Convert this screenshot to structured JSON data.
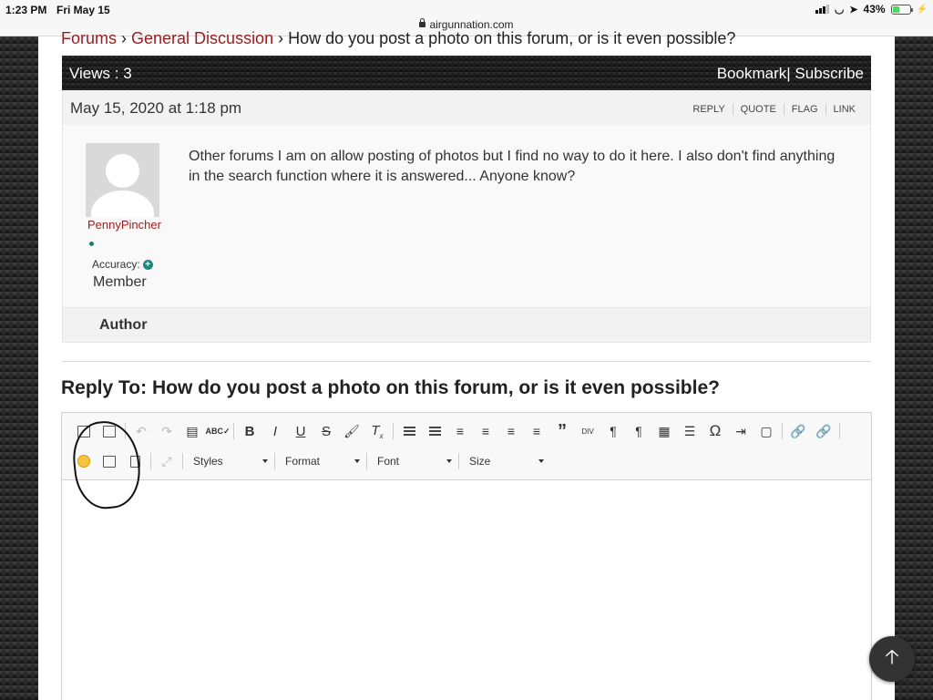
{
  "status_bar": {
    "time": "1:23 PM",
    "date": "Fri May 15",
    "url": "airgunnation.com",
    "battery": "43%",
    "battery_level": 0.43
  },
  "breadcrumb": {
    "forums": "Forums",
    "sep1": " › ",
    "category": "General Discussion",
    "sep2": " › ",
    "topic": "How do you post a photo on this forum, or is it even possible?"
  },
  "views_bar": {
    "views": "Views : 3",
    "bookmark": "Bookmark",
    "separator": "|",
    "subscribe": " Subscribe"
  },
  "post": {
    "date": "May 15, 2020 at 1:18 pm",
    "links": [
      "REPLY",
      "QUOTE",
      "FLAG",
      "LINK"
    ],
    "author": "PennyPincher",
    "accuracy_label": "Accuracy:",
    "role": "Member",
    "text": "Other forums I am on allow posting of photos but I find no way to do it here.  I also don't find anything in the search function where it is answered... Anyone know?"
  },
  "author_header": "Author",
  "reply_title": "Reply To: How do you post a photo on this forum, or is it even possible?",
  "editor": {
    "combos": [
      "Styles",
      "Format",
      "Font",
      "Size"
    ],
    "toolbar_icons_row1": [
      "paste-text-icon",
      "paste-word-icon",
      "undo-icon",
      "redo-icon",
      "template-icon",
      "spellcheck-icon",
      "bold-icon",
      "italic-icon",
      "underline-icon",
      "strikethrough-icon",
      "copy-format-icon",
      "remove-format-icon",
      "numbered-list-icon",
      "bulleted-list-icon",
      "align-left-icon",
      "align-center-icon",
      "align-right-icon",
      "justify-icon",
      "blockquote-icon",
      "div-icon",
      "ltr-icon",
      "rtl-icon",
      "table-icon",
      "horizontal-rule-icon",
      "special-char-icon",
      "indent-icon",
      "iframe-icon",
      "link-icon",
      "unlink-icon"
    ],
    "toolbar_icons_row2": [
      "smiley-icon",
      "image-icon",
      "document-icon",
      "maximize-icon"
    ]
  }
}
